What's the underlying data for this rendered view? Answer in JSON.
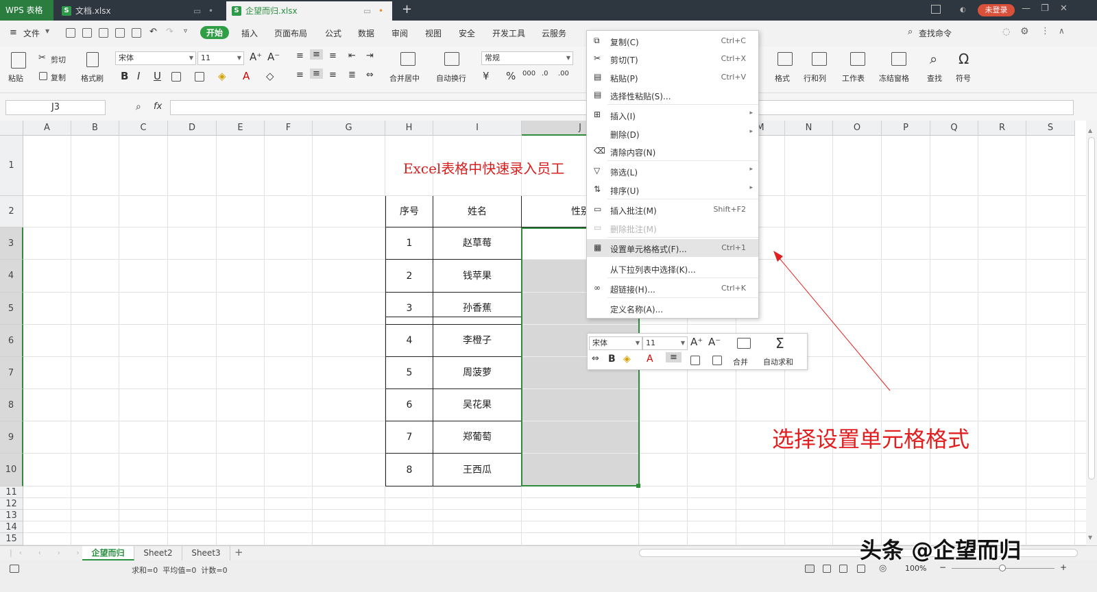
{
  "titlebar": {
    "app_tab": "WPS 表格",
    "tabs": [
      {
        "label": "文档.xlsx"
      },
      {
        "label": "企望而归.xlsx"
      }
    ],
    "new_tab": "+",
    "login": "未登录"
  },
  "menubar": {
    "file": "文件",
    "items": [
      "开始",
      "插入",
      "页面布局",
      "公式",
      "数据",
      "审阅",
      "视图",
      "安全",
      "开发工具",
      "云服务"
    ],
    "search": "查找命令"
  },
  "ribbon": {
    "paste": "粘贴",
    "cut": "剪切",
    "copy": "复制",
    "format_painter": "格式刷",
    "font_name": "宋体",
    "font_size": "11",
    "number_format": "常规",
    "merge_center": "合并居中",
    "wrap": "自动换行",
    "format": "格式",
    "rows_cols": "行和列",
    "worksheet": "工作表",
    "freeze": "冻结窗格",
    "find": "查找",
    "symbol": "符号"
  },
  "formula_bar": {
    "name_box": "J3",
    "fx": "fx",
    "value": ""
  },
  "grid": {
    "columns": [
      "A",
      "B",
      "C",
      "D",
      "E",
      "F",
      "G",
      "H",
      "I",
      "J",
      "K",
      "L",
      "M",
      "N",
      "O",
      "P",
      "Q",
      "R",
      "S"
    ],
    "rows": [
      "1",
      "2",
      "3",
      "4",
      "5",
      "6",
      "7",
      "8",
      "9",
      "10",
      "11",
      "12",
      "13",
      "14",
      "15"
    ],
    "title": "Excel表格中快速录入员工",
    "headers": [
      "序号",
      "姓名",
      "性别"
    ],
    "records": [
      {
        "no": "1",
        "name": "赵草莓"
      },
      {
        "no": "2",
        "name": "钱苹果"
      },
      {
        "no": "3",
        "name": "孙香蕉"
      },
      {
        "no": "4",
        "name": "李橙子"
      },
      {
        "no": "5",
        "name": "周菠萝"
      },
      {
        "no": "6",
        "name": "吴花果"
      },
      {
        "no": "7",
        "name": "郑葡萄"
      },
      {
        "no": "8",
        "name": "王西瓜"
      }
    ]
  },
  "context_menu": [
    {
      "label": "复制(C)",
      "shortcut": "Ctrl+C",
      "icon": "copy-icon"
    },
    {
      "label": "剪切(T)",
      "shortcut": "Ctrl+X",
      "icon": "scissors-icon"
    },
    {
      "label": "粘贴(P)",
      "shortcut": "Ctrl+V",
      "icon": "paste-icon"
    },
    {
      "label": "选择性粘贴(S)...",
      "shortcut": "",
      "icon": "paste-special-icon"
    },
    {
      "label": "插入(I)",
      "shortcut": "",
      "icon": "insert-icon"
    },
    {
      "label": "删除(D)",
      "shortcut": "",
      "icon": ""
    },
    {
      "label": "清除内容(N)",
      "shortcut": "",
      "icon": "eraser-icon"
    },
    {
      "label": "筛选(L)",
      "shortcut": "",
      "icon": "filter-icon"
    },
    {
      "label": "排序(U)",
      "shortcut": "",
      "icon": "sort-icon"
    },
    {
      "label": "插入批注(M)",
      "shortcut": "Shift+F2",
      "icon": "comment-icon"
    },
    {
      "label": "删除批注(M)",
      "shortcut": "",
      "icon": "delete-comment-icon"
    },
    {
      "label": "设置单元格格式(F)...",
      "shortcut": "Ctrl+1",
      "icon": "format-cells-icon"
    },
    {
      "label": "从下拉列表中选择(K)...",
      "shortcut": "",
      "icon": ""
    },
    {
      "label": "超链接(H)...",
      "shortcut": "Ctrl+K",
      "icon": "link-icon"
    },
    {
      "label": "定义名称(A)...",
      "shortcut": "",
      "icon": ""
    }
  ],
  "mini_toolbar": {
    "font_name": "宋体",
    "font_size": "11",
    "merge": "合并",
    "autosum": "自动求和"
  },
  "annotation": {
    "text": "选择设置单元格格式",
    "color": "#e02020"
  },
  "sheets": [
    {
      "label": "企望而归"
    },
    {
      "label": "Sheet2"
    },
    {
      "label": "Sheet3"
    }
  ],
  "status": {
    "summary": "求和=0  平均值=0  计数=0",
    "zoom": "100%",
    "watermark": "头条 @企望而归"
  }
}
